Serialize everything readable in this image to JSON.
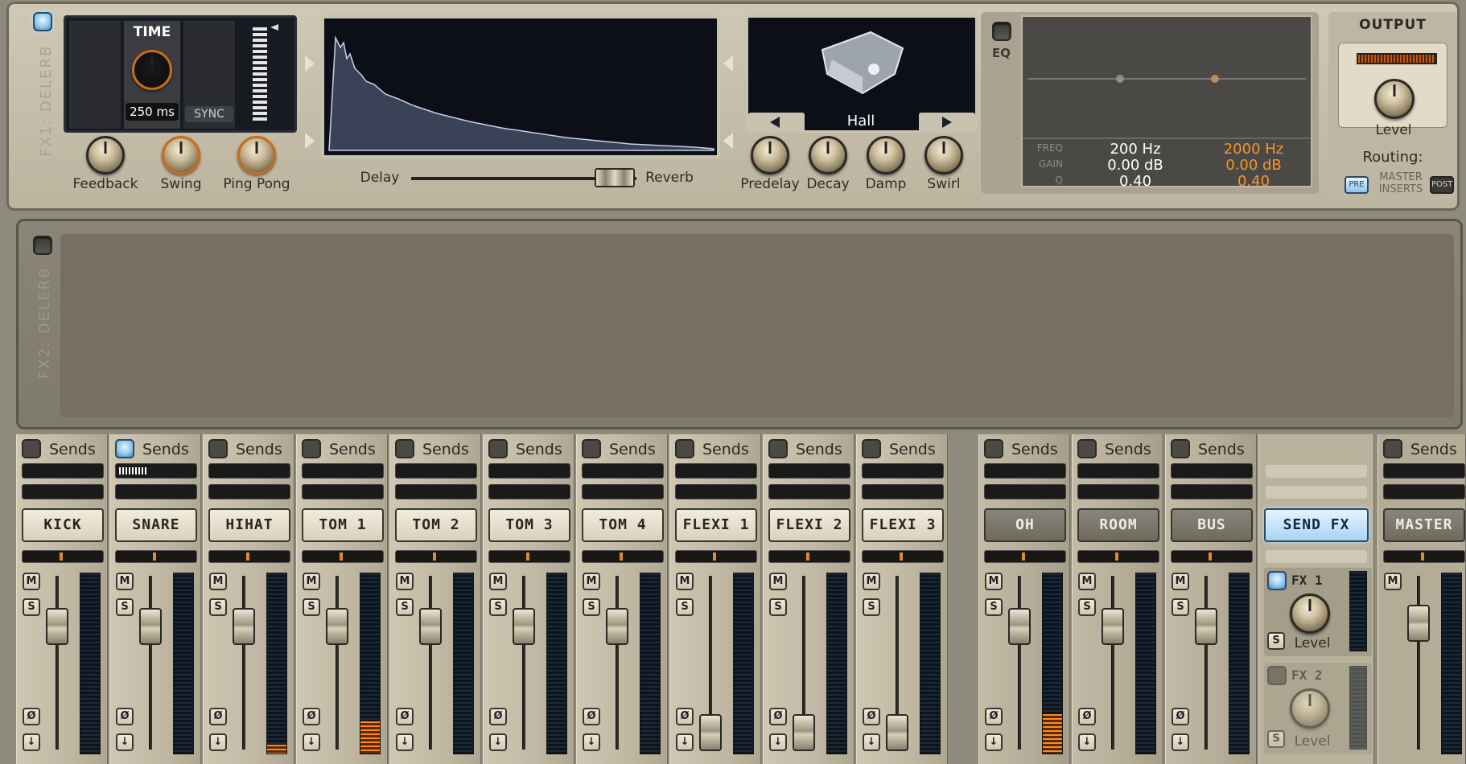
{
  "fx1": {
    "label": "FX1: DELERB",
    "time_title": "TIME",
    "time_value": "250 ms",
    "sync_label": "SYNC",
    "knobs": [
      "Feedback",
      "Swing",
      "Ping Pong"
    ],
    "delay_label": "Delay",
    "reverb_label": "Reverb",
    "room_type": "Hall",
    "reverb_knobs": [
      "Predelay",
      "Decay",
      "Damp",
      "Swirl"
    ],
    "eq_label": "EQ",
    "eq_rows": [
      "FREQ",
      "GAIN",
      "Q"
    ],
    "eq_band1": {
      "freq": "200 Hz",
      "gain": "0.00 dB",
      "q": "0.40"
    },
    "eq_band2": {
      "freq": "2000 Hz",
      "gain": "0.00 dB",
      "q": "0.40"
    },
    "output_title": "OUTPUT",
    "level_label": "Level",
    "routing_label": "Routing:",
    "pre_label": "PRE",
    "master_label": "MASTER",
    "inserts_label": "INSERTS",
    "post_label": "POST"
  },
  "fx2": {
    "label": "FX2: DELERB"
  },
  "mixer": {
    "sends_label": "Sends",
    "mute_label": "M",
    "solo_label": "S",
    "phase_label": "Ø",
    "down_label": "↓",
    "channels": [
      {
        "name": "KICK",
        "sends_on": false,
        "meter": 0
      },
      {
        "name": "SNARE",
        "sends_on": true,
        "meter": 0
      },
      {
        "name": "HIHAT",
        "sends_on": false,
        "meter": 0.05
      },
      {
        "name": "TOM 1",
        "sends_on": false,
        "meter": 0.18
      },
      {
        "name": "TOM 2",
        "sends_on": false,
        "meter": 0
      },
      {
        "name": "TOM 3",
        "sends_on": false,
        "meter": 0
      },
      {
        "name": "TOM 4",
        "sends_on": false,
        "meter": 0
      },
      {
        "name": "FLEXI 1",
        "sends_on": false,
        "meter": 0
      },
      {
        "name": "FLEXI 2",
        "sends_on": false,
        "meter": 0
      },
      {
        "name": "FLEXI 3",
        "sends_on": false,
        "meter": 0
      }
    ],
    "buses": [
      {
        "name": "OH",
        "meter": 0.22
      },
      {
        "name": "ROOM",
        "meter": 0
      },
      {
        "name": "BUS",
        "meter": 0
      }
    ],
    "sendfx": {
      "name": "SEND FX",
      "fx1_label": "FX 1",
      "fx2_label": "FX 2",
      "level_label": "Level"
    },
    "master": {
      "name": "MASTER"
    }
  },
  "colors": {
    "accent_orange": "#e08a2a",
    "led_blue": "#8cc4ec",
    "panel": "#cfc7b2"
  }
}
